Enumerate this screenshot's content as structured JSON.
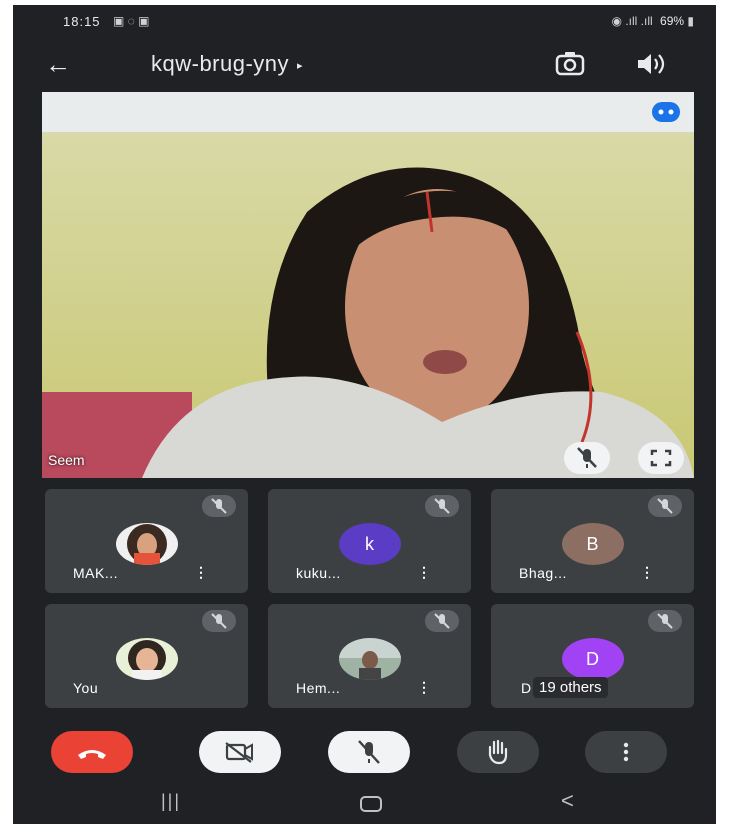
{
  "status_bar": {
    "time": "18:15",
    "left_icons": "▣ ◌ ▣",
    "network": "◉ .ıll .ıll",
    "battery": "69%"
  },
  "app_bar": {
    "back_icon": "arrow-left",
    "meeting_code": "kqw-brug-yny",
    "caret": "▸",
    "switch_camera_icon": "camera-switch",
    "speaker_icon": "speaker"
  },
  "main_video": {
    "speaker_name": "Seem",
    "caption_icon": "captions",
    "mute_icon": "mic-off",
    "fullscreen_icon": "fullscreen"
  },
  "participants": [
    {
      "name": "MAK...",
      "avatar_type": "photo",
      "muted": true,
      "has_menu": true
    },
    {
      "name": "kuku...",
      "avatar_letter": "k",
      "avatar_color": "#5b3cc4",
      "muted": true,
      "has_menu": true
    },
    {
      "name": "Bhag...",
      "avatar_letter": "B",
      "avatar_color": "#8d6e63",
      "muted": true,
      "has_menu": true
    },
    {
      "name": "You",
      "avatar_type": "photo",
      "muted": true,
      "has_menu": false
    },
    {
      "name": "Hem...",
      "avatar_type": "photo",
      "muted": true,
      "has_menu": true
    },
    {
      "name": "19 others",
      "avatar_letter": "D",
      "avatar_color": "#a142f4",
      "muted": true,
      "has_menu": false
    }
  ],
  "others_prefix": "D",
  "controls": {
    "end_call_icon": "phone-hangup",
    "camera_icon": "video-off",
    "mic_icon": "mic-off",
    "raise_hand_icon": "hand",
    "more_icon": "more-vertical"
  },
  "colors": {
    "end_call": "#ea4335",
    "background": "#202124",
    "tile": "#3c4043",
    "accent_blue": "#1a73e8"
  }
}
